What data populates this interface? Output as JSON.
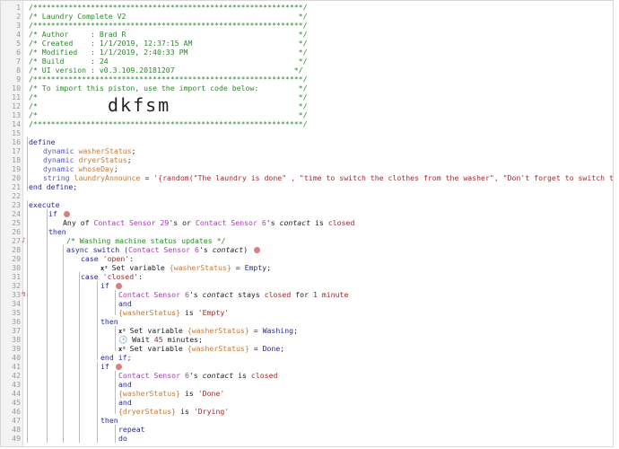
{
  "lines": [
    {
      "n": "1",
      "t": "/*************************************************************/"
    },
    {
      "n": "2",
      "t": "/* Laundry Complete V2                                       */"
    },
    {
      "n": "3",
      "t": "/*************************************************************/"
    },
    {
      "n": "4",
      "t": "/* Author     : Brad R                                       */"
    },
    {
      "n": "5",
      "t": "/* Created    : 1/1/2019, 12:37:15 AM                        */"
    },
    {
      "n": "6",
      "t": "/* Modified   : 1/1/2019, 2:40:33 PM                         */"
    },
    {
      "n": "7",
      "t": "/* Build      : 24                                           */"
    },
    {
      "n": "8",
      "t": "/* UI version : v0.3.109.20181207                           */"
    },
    {
      "n": "9",
      "t": "/*************************************************************/"
    },
    {
      "n": "10",
      "t": "/* To import this piston, use the import code below:         */"
    },
    {
      "n": "11",
      "t": "/*                                                           */"
    },
    {
      "n": "12",
      "t": "/*                                                           */"
    },
    {
      "n": "13",
      "t": "/*                                                           */"
    },
    {
      "n": "14",
      "t": "/*************************************************************/"
    },
    {
      "n": "15",
      "t": ""
    },
    {
      "n": "16",
      "t": "define"
    },
    {
      "n": "17",
      "t": "dynamic washerStatus;"
    },
    {
      "n": "18",
      "t": "dynamic dryerStatus;"
    },
    {
      "n": "19",
      "t": "dynamic whoseDay;"
    },
    {
      "n": "20",
      "t": "string laundryAnnounce = '{random(\"The laundry is done\" , \"time to switch the clothes from the washer\", \"Don't forget to switch the laundry\")}';"
    },
    {
      "n": "21",
      "t": "end define;"
    },
    {
      "n": "22",
      "t": ""
    },
    {
      "n": "23",
      "t": "execute"
    },
    {
      "n": "24",
      "t": "if"
    },
    {
      "n": "25",
      "t": "Any of Contact Sensor 29's or Contact Sensor 6's contact is closed"
    },
    {
      "n": "26",
      "t": "then"
    },
    {
      "n": "27",
      "t": "/* Washing machine status updates */"
    },
    {
      "n": "28",
      "t": "async switch (Contact Sensor 6's contact)"
    },
    {
      "n": "29",
      "t": "case 'open':"
    },
    {
      "n": "30",
      "t": "Set variable {washerStatus} = Empty;"
    },
    {
      "n": "31",
      "t": "case 'closed':"
    },
    {
      "n": "32",
      "t": "if"
    },
    {
      "n": "33",
      "t": "Contact Sensor 6's contact stays closed for 1 minute"
    },
    {
      "n": "34",
      "t": "and"
    },
    {
      "n": "35",
      "t": "{washerStatus} is 'Empty'"
    },
    {
      "n": "36",
      "t": "then"
    },
    {
      "n": "37",
      "t": "Set variable {washerStatus} = Washing;"
    },
    {
      "n": "38",
      "t": "Wait 45 minutes;"
    },
    {
      "n": "39",
      "t": "Set variable {washerStatus} = Done;"
    },
    {
      "n": "40",
      "t": "end if;"
    },
    {
      "n": "41",
      "t": "if"
    },
    {
      "n": "42",
      "t": "Contact Sensor 6's contact is closed"
    },
    {
      "n": "43",
      "t": "and"
    },
    {
      "n": "44",
      "t": "{washerStatus} is 'Done'"
    },
    {
      "n": "45",
      "t": "and"
    },
    {
      "n": "46",
      "t": "{dryerStatus} is 'Drying'"
    },
    {
      "n": "47",
      "t": "then"
    },
    {
      "n": "48",
      "t": "repeat"
    },
    {
      "n": "49",
      "t": "do"
    }
  ],
  "import_code": "dkfsm",
  "parts": {
    "l17_kw": "dynamic",
    "l17_var": "washerStatus",
    "l17_end": ";",
    "l18_kw": "dynamic",
    "l18_var": "dryerStatus",
    "l18_end": ";",
    "l19_kw": "dynamic",
    "l19_var": "whoseDay",
    "l19_end": ";",
    "l20_kw": "string",
    "l20_var": "laundryAnnounce",
    "l20_eq": " = ",
    "l20_str": "'{random(\"The laundry is done\" , \"time to switch the clothes from the washer\", \"Don't forget to switch the laundry\")}'",
    "l20_end": ";",
    "l25_a": "Any of ",
    "l25_d1": "Contact Sensor 29",
    "l25_b": "'s or ",
    "l25_d2": "Contact Sensor 6",
    "l25_c": "'s ",
    "l25_attr": "contact",
    "l25_is": " is ",
    "l25_val": "closed",
    "l28_a": "async switch (",
    "l28_d": "Contact Sensor 6",
    "l28_b": "'s ",
    "l28_attr": "contact",
    ")": ")",
    "l29_kw": "case ",
    "l29_str": "'open'",
    "l29_c": ":",
    "l30_a": "Set variable ",
    "l30_var": "{washerStatus}",
    "l30_eq": " = ",
    "l30_val": "Empty",
    "l30_end": ";",
    "l31_kw": "case ",
    "l31_str": "'closed'",
    "l31_c": ":",
    "l33_d": "Contact Sensor 6",
    "l33_b": "'s ",
    "l33_attr": "contact",
    "l33_op": " stays ",
    "l33_v": "closed",
    "l33_for": " for ",
    "l33_dur": "1 minute",
    "l35_var": "{washerStatus}",
    "l35_is": " is ",
    "l35_str": "'Empty'",
    "l37_a": "Set variable ",
    "l37_var": "{washerStatus}",
    "l37_eq": " = ",
    "l37_val": "Washing",
    "l37_end": ";",
    "l38_a": "Wait ",
    "l38_n": "45",
    "l38_b": " minutes;",
    "l39_a": "Set variable ",
    "l39_var": "{washerStatus}",
    "l39_eq": " = ",
    "l39_val": "Done",
    "l39_end": ";",
    "l42_d": "Contact Sensor 6",
    "l42_b": "'s ",
    "l42_attr": "contact",
    "l42_is": " is ",
    "l42_v": "closed",
    "l44_var": "{washerStatus}",
    "l44_is": " is ",
    "l44_str": "'Done'",
    "l46_var": "{dryerStatus}",
    "l46_is": " is ",
    "l46_str": "'Drying'"
  },
  "icons": {
    "expression": "x²",
    "wait": "clock-icon",
    "condition": "condition-badge-icon"
  },
  "colors": {
    "comment": "#2a8a2a",
    "keyword": "#2a2a9a",
    "variable": "#c47b3a",
    "string": "#a12a2a",
    "device": "#a23fb0"
  }
}
